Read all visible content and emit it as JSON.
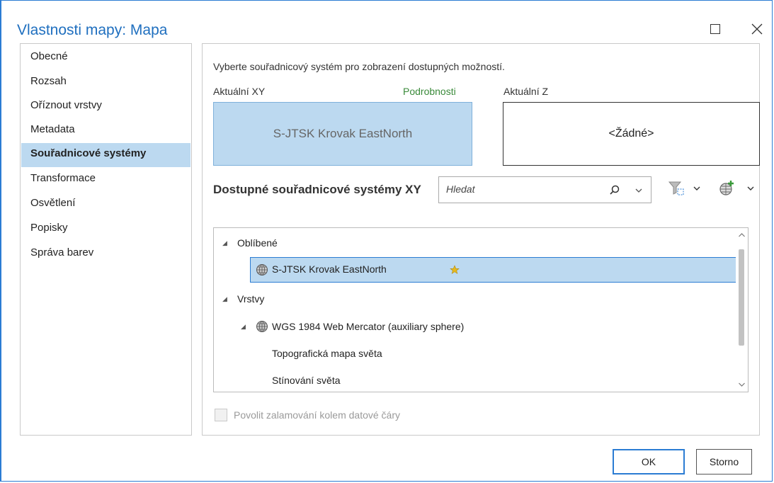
{
  "window": {
    "title": "Vlastnosti mapy: Mapa"
  },
  "nav": {
    "items": [
      "Obecné",
      "Rozsah",
      "Oříznout vrstvy",
      "Metadata",
      "Souřadnicové systémy",
      "Transformace",
      "Osvětlení",
      "Popisky",
      "Správa barev"
    ],
    "selected": "Souřadnicové systémy"
  },
  "content": {
    "instruction": "Vyberte souřadnicový systém pro zobrazení dostupných možností.",
    "current_xy_label": "Aktuální XY",
    "details_link": "Podrobnosti",
    "current_z_label": "Aktuální Z",
    "current_xy_value": "S-JTSK Krovak EastNorth",
    "current_z_value": "<Žádné>",
    "available_heading": "Dostupné souřadnicové systémy XY",
    "search": {
      "placeholder": "Hledat",
      "value": ""
    },
    "tree": {
      "favorites_label": "Oblíbené",
      "favorite_item": "S-JTSK Krovak EastNorth",
      "layers_label": "Vrstvy",
      "layer_crs": "WGS 1984 Web Mercator (auxiliary sphere)",
      "layer_1": "Topografická mapa světa",
      "layer_2": "Stínování světa"
    },
    "wrap_checkbox": {
      "label": "Povolit zalamování kolem datové čáry",
      "checked": false,
      "enabled": false
    }
  },
  "buttons": {
    "ok": "OK",
    "cancel": "Storno"
  },
  "colors": {
    "accent": "#2b7cd3",
    "selection": "#bcd9f0",
    "link_green": "#3a8a3a"
  }
}
